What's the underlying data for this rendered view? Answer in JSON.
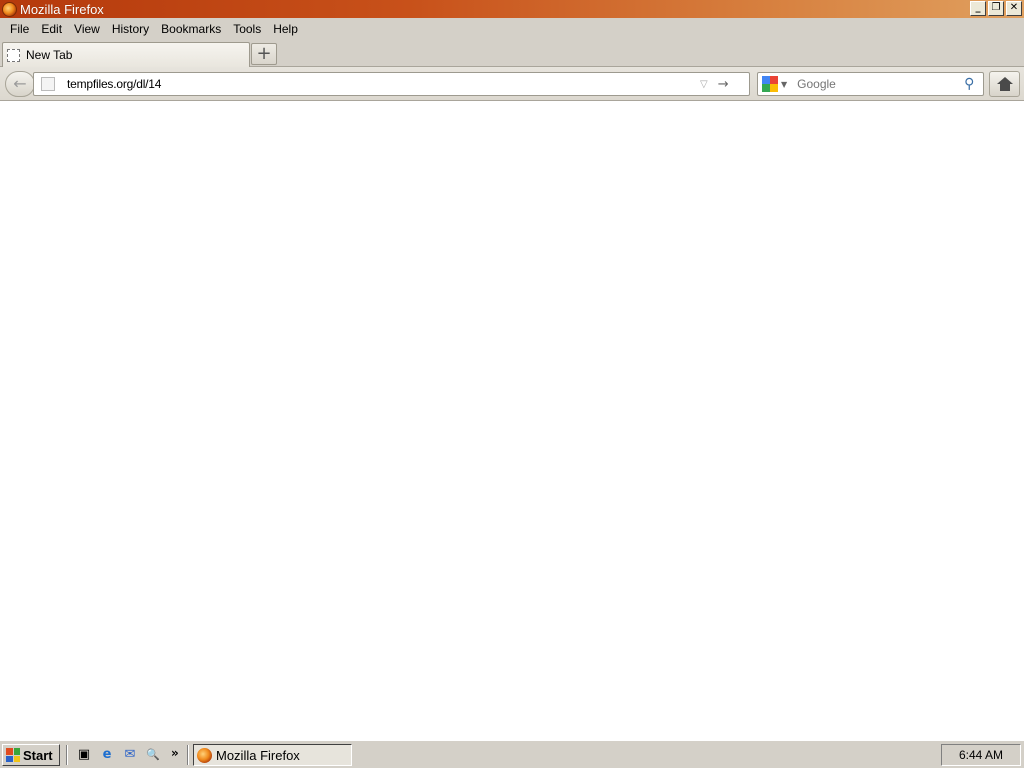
{
  "window": {
    "title": "Mozilla Firefox",
    "controls": {
      "minimize": "_",
      "restore": "❐",
      "close": "✕"
    }
  },
  "menubar": {
    "items": [
      {
        "label": "File"
      },
      {
        "label": "Edit"
      },
      {
        "label": "View"
      },
      {
        "label": "History"
      },
      {
        "label": "Bookmarks"
      },
      {
        "label": "Tools"
      },
      {
        "label": "Help"
      }
    ]
  },
  "tabs": {
    "items": [
      {
        "label": "New Tab",
        "active": true
      }
    ],
    "new_tab_label": "+"
  },
  "navbar": {
    "back_glyph": "←",
    "url": {
      "value": "tempfiles.org/dl/14",
      "dropmarker": "▽",
      "go": "→"
    },
    "search": {
      "placeholder": "Google",
      "engine_caret": "▼",
      "go": "⚲"
    }
  },
  "taskbar": {
    "start_label": "Start",
    "quicklaunch": [
      {
        "name": "show-desktop",
        "glyph": "▣"
      },
      {
        "name": "internet-explorer",
        "glyph": "e"
      },
      {
        "name": "outlook-express",
        "glyph": "✉"
      },
      {
        "name": "search",
        "glyph": "🔍"
      }
    ],
    "quicklaunch_more": "»",
    "task_label": "Mozilla Firefox",
    "clock": "6:44 AM"
  },
  "colors": {
    "titlebar_start": "#b5390c",
    "titlebar_end": "#e0a05f",
    "chrome_bg": "#d4d0c8"
  }
}
